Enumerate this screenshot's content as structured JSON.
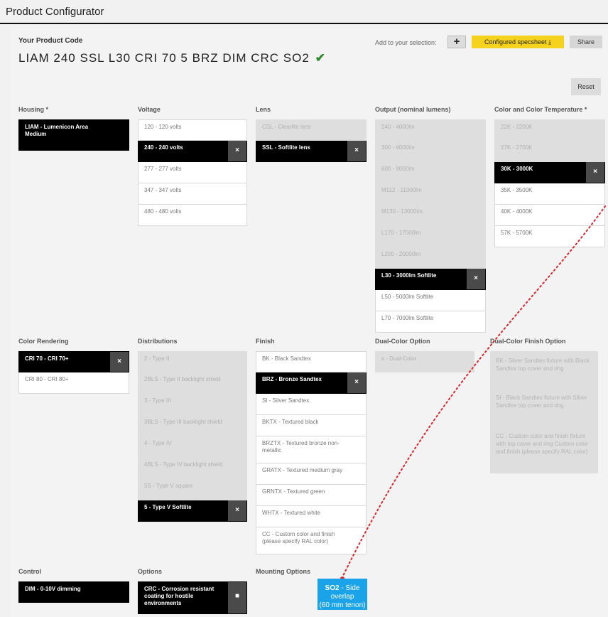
{
  "page": {
    "title": "Product Configurator"
  },
  "product_code": {
    "label": "Your Product Code",
    "code": "LIAM 240 SSL L30 CRI 70 5 BRZ DIM CRC SO2",
    "check": "✔"
  },
  "toolbar": {
    "add_label": "Add to your selection:",
    "add_button": "+",
    "spec_button": "Configured specsheet ⤓",
    "share_button": "Share",
    "reset_button": "Reset"
  },
  "groups": {
    "housing": {
      "title": "Housing *",
      "options": [
        "LIAM - Lumenicon Area Medium"
      ]
    },
    "voltage": {
      "title": "Voltage",
      "options": [
        "120 - 120 volts",
        "240 - 240 volts",
        "277 - 277 volts",
        "347 - 347 volts",
        "480 - 480 volts"
      ]
    },
    "lens": {
      "title": "Lens",
      "options": [
        "CSL - Clearlite lens",
        "SSL - Softlite lens"
      ]
    },
    "output": {
      "title": "Output (nominal lumens)",
      "options": [
        "240 - 4000lm",
        "300 - 6000lm",
        "600 - 9000lm",
        "M112 - 11000lm",
        "M130 - 13000lm",
        "L170 - 17000lm",
        "L200 - 20000lm",
        "L30 - 3000lm Softlite",
        "L50 - 5000lm Softlite",
        "L70 - 7000lm Softlite"
      ]
    },
    "color_temp": {
      "title": "Color and Color Temperature *",
      "options": [
        "22K - 2200K",
        "27K - 2700K",
        "30K - 3000K",
        "35K - 3500K",
        "40K - 4000K",
        "57K - 5700K"
      ]
    },
    "color_rendering": {
      "title": "Color Rendering",
      "options": [
        "CRI 70 - CRI 70+",
        "CRI 80 - CRI 80+"
      ]
    },
    "distributions": {
      "title": "Distributions",
      "options": [
        "2 - Type II",
        "2BLS - Type II backlight shield",
        "3 - Type III",
        "3BLS - Type III backlight shield",
        "4 - Type IV",
        "4BLS - Type IV backlight shield",
        "5S - Type V square",
        "5 - Type V Softlite"
      ]
    },
    "finish": {
      "title": "Finish",
      "options": [
        "BK - Black Sandtex",
        "BRZ - Bronze Sandtex",
        "SI - Silver Sandtex",
        "BKTX - Textured black",
        "BRZTX - Textured bronze non-metallic",
        "GRATX - Textured medium gray",
        "GRNTX - Textured green",
        "WHTX - Textured white",
        "CC - Custom color and finish (please specify RAL color)"
      ]
    },
    "dual_color": {
      "title": "Dual-Color Option",
      "options": [
        "x - Dual-Color"
      ]
    },
    "dual_finish": {
      "title": "Dual-Color Finish Option",
      "options": [
        "BK - Silver Sandtex fixture with Black Sandtex top cover and ring",
        "SI - Black Sandtex fixture with Silver Sandtex top cover and ring",
        "CC - Custom color and finish fixture with top cover and ring Custom color and finish (please specify RAL color)"
      ]
    },
    "control": {
      "title": "Control",
      "options": [
        "DIM - 0-10V dimming"
      ]
    },
    "options_group": {
      "title": "Options",
      "options": [
        "CRC - Corrosion resistant coating for hostile environments"
      ]
    },
    "mounting": {
      "title": "Mounting Options"
    }
  },
  "callout": {
    "code": "SO2",
    "text": " - Side overlap",
    "sub": "(60 mm tenon)",
    "color": "#1aa3e8"
  },
  "colors": {
    "selected": "#000000",
    "accent_yellow": "#f4d21d",
    "leader": "#d8262c"
  }
}
